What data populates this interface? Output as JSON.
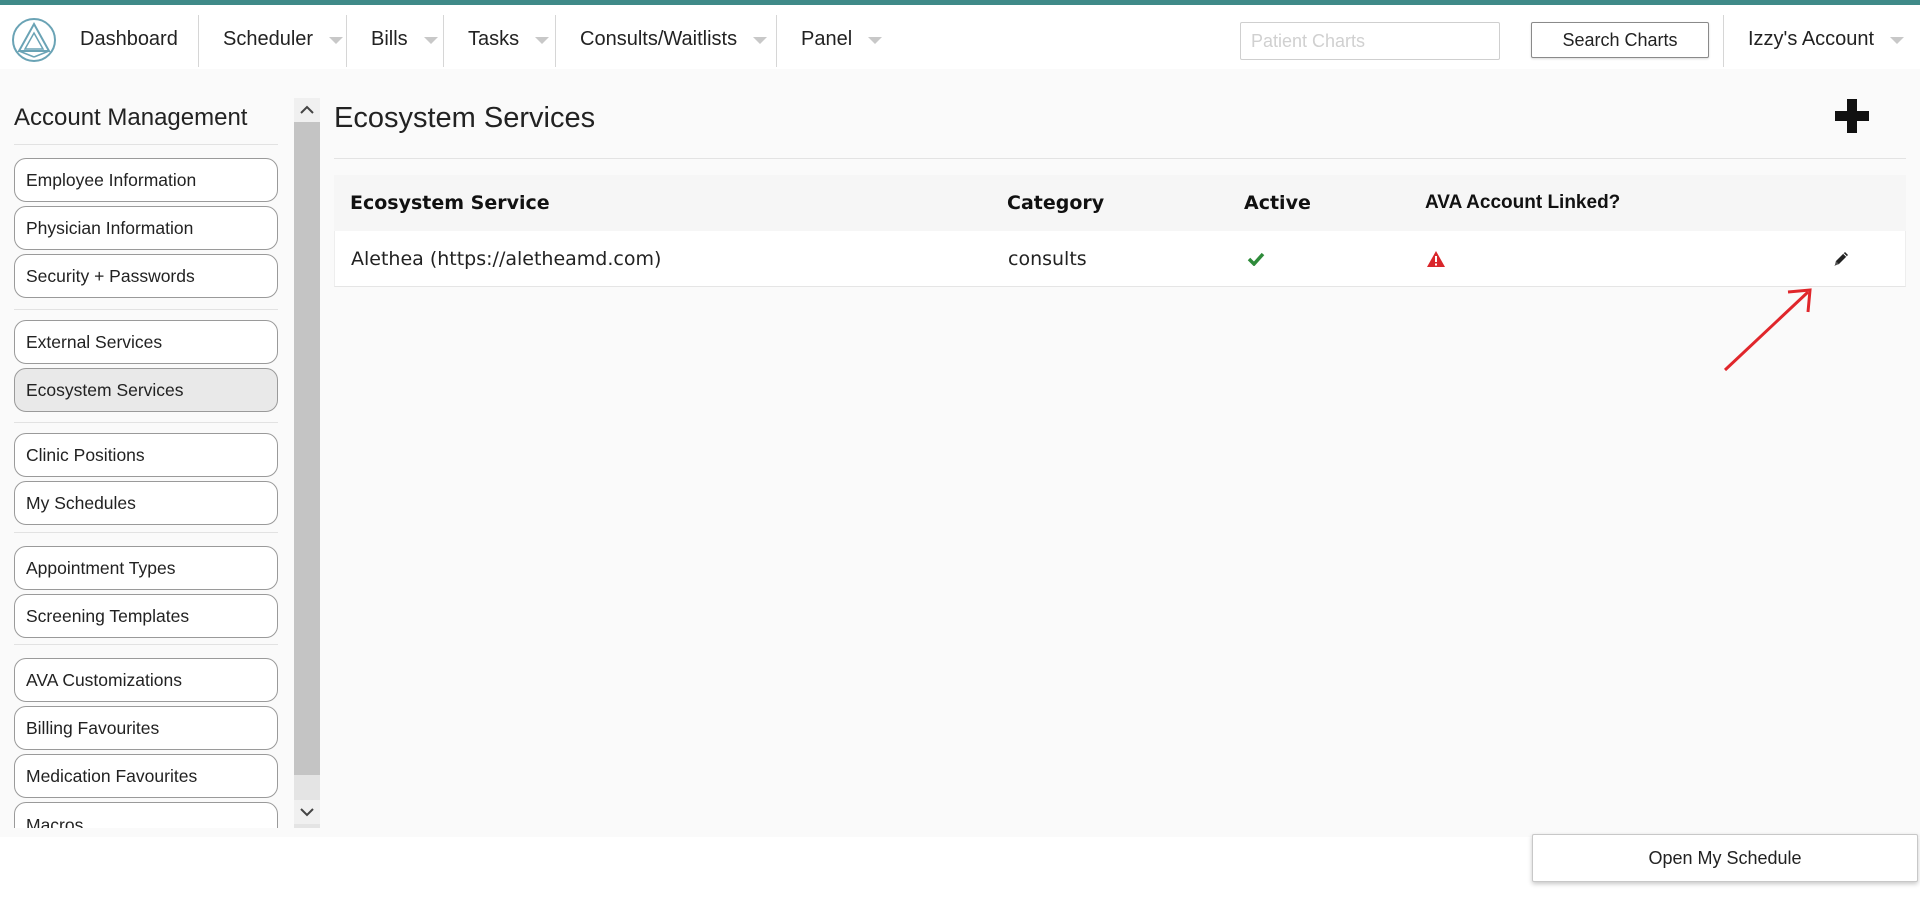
{
  "nav": {
    "items": [
      {
        "label": "Dashboard"
      },
      {
        "label": "Scheduler"
      },
      {
        "label": "Bills"
      },
      {
        "label": "Tasks"
      },
      {
        "label": "Consults/Waitlists"
      },
      {
        "label": "Panel"
      }
    ],
    "search_placeholder": "Patient Charts",
    "search_button": "Search Charts",
    "account_label": "Izzy's Account"
  },
  "sidebar": {
    "title": "Account Management",
    "groups": [
      [
        "Employee Information",
        "Physician Information",
        "Security + Passwords"
      ],
      [
        "External Services",
        "Ecosystem Services"
      ],
      [
        "Clinic Positions",
        "My Schedules"
      ],
      [
        "Appointment Types",
        "Screening Templates"
      ],
      [
        "AVA Customizations",
        "Billing Favourites",
        "Medication Favourites",
        "Macros"
      ]
    ],
    "active_item": "Ecosystem Services"
  },
  "main": {
    "title": "Ecosystem Services",
    "table": {
      "headers": [
        "Ecosystem Service",
        "Category",
        "Active",
        "AVA Account Linked?"
      ],
      "rows": [
        {
          "service": "Alethea (https://aletheamd.com)",
          "category": "consults",
          "active_icon": "check-icon",
          "linked_icon": "warning-icon",
          "action_icon": "pencil-icon"
        }
      ]
    }
  },
  "colors": {
    "accent_bar": "#3f8a88",
    "check": "#2e8b3a",
    "warning": "#d9262b",
    "annotation_arrow": "#e0262b"
  },
  "footer": {
    "open_schedule": "Open My Schedule"
  }
}
